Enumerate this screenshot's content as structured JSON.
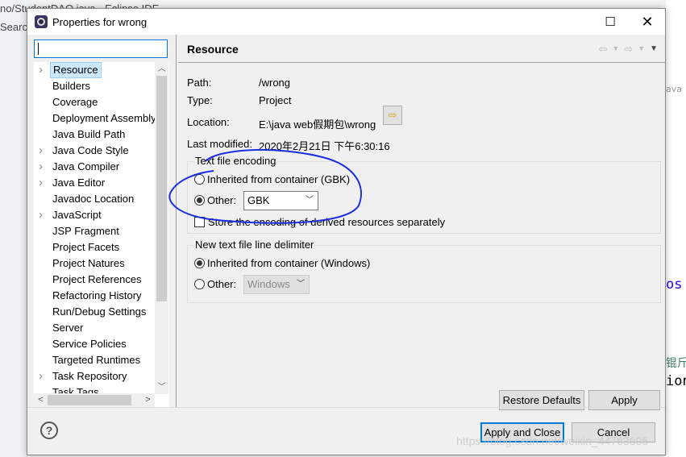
{
  "background": {
    "left_text": [
      "no/StudentDAO.java - Eclipse IDE",
      "Search"
    ],
    "right_text": [
      "ava",
      "os",
      "ion",
      "锟斤"
    ]
  },
  "dialog": {
    "title": "Properties for wrong",
    "filter_value": "",
    "tree": [
      {
        "label": "Resource",
        "expandable": true,
        "selected": true
      },
      {
        "label": "Builders"
      },
      {
        "label": "Coverage"
      },
      {
        "label": "Deployment Assembly"
      },
      {
        "label": "Java Build Path"
      },
      {
        "label": "Java Code Style",
        "expandable": true
      },
      {
        "label": "Java Compiler",
        "expandable": true
      },
      {
        "label": "Java Editor",
        "expandable": true
      },
      {
        "label": "Javadoc Location"
      },
      {
        "label": "JavaScript",
        "expandable": true
      },
      {
        "label": "JSP Fragment"
      },
      {
        "label": "Project Facets"
      },
      {
        "label": "Project Natures"
      },
      {
        "label": "Project References"
      },
      {
        "label": "Refactoring History"
      },
      {
        "label": "Run/Debug Settings"
      },
      {
        "label": "Server"
      },
      {
        "label": "Service Policies"
      },
      {
        "label": "Targeted Runtimes"
      },
      {
        "label": "Task Repository",
        "expandable": true
      },
      {
        "label": "Task Tags"
      }
    ],
    "page": {
      "heading": "Resource",
      "path_label": "Path:",
      "path": "/wrong",
      "type_label": "Type:",
      "type": "Project",
      "location_label": "Location:",
      "location": "E:\\java web假期包\\wrong",
      "modified_label": "Last modified:",
      "modified": "2020年2月21日 下午6:30:16",
      "encoding": {
        "title": "Text file encoding",
        "inherited": "Inherited from container (GBK)",
        "other": "Other:",
        "other_value": "GBK",
        "selected": "other",
        "store_derived": "Store the encoding of derived resources separately",
        "store_derived_checked": false
      },
      "delimiter": {
        "title": "New text file line delimiter",
        "inherited": "Inherited from container (Windows)",
        "other": "Other:",
        "other_value": "Windows",
        "selected": "inherited"
      },
      "restore_defaults": "Restore Defaults",
      "apply": "Apply"
    },
    "apply_close": "Apply and Close",
    "cancel": "Cancel"
  },
  "watermark": "https://blog.csdn.net/weixin_44763595",
  "annotation_color": "#1a2ee0"
}
